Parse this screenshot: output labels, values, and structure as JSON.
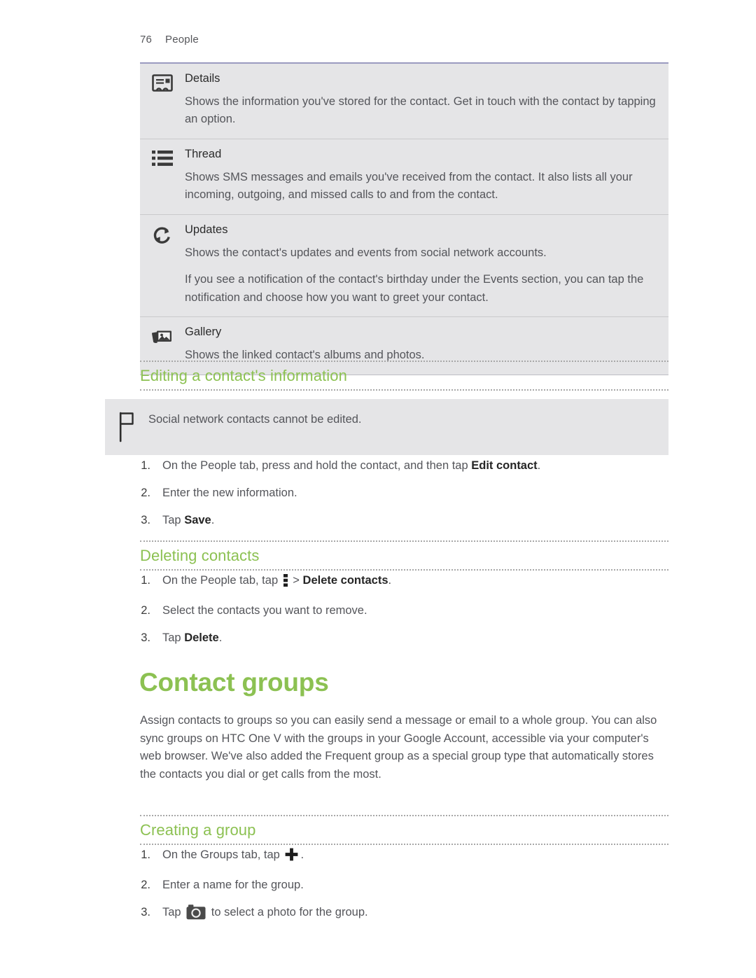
{
  "running_head": {
    "page_number": "76",
    "title": "People"
  },
  "feature_table": {
    "rows": [
      {
        "icon": "contact-card-icon",
        "title": "Details",
        "paragraphs": [
          "Shows the information you've stored for the contact. Get in touch with the contact by tapping an option."
        ]
      },
      {
        "icon": "list-thread-icon",
        "title": "Thread",
        "paragraphs": [
          "Shows SMS messages and emails you've received from the contact. It also lists all your incoming, outgoing, and missed calls to and from the contact."
        ]
      },
      {
        "icon": "refresh-updates-icon",
        "title": "Updates",
        "paragraphs": [
          "Shows the contact's updates and events from social network accounts.",
          "If you see a notification of the contact's birthday under the Events section, you can tap the notification and choose how you want to greet your contact."
        ]
      },
      {
        "icon": "gallery-photos-icon",
        "title": "Gallery",
        "paragraphs": [
          "Shows the linked contact's albums and photos."
        ]
      }
    ]
  },
  "section_editing": {
    "heading": "Editing a contact's information",
    "note": {
      "icon": "flag-icon",
      "text": "Social network contacts cannot be edited."
    },
    "steps": [
      {
        "num": "1.",
        "pre": "On the People tab, press and hold the contact, and then tap ",
        "bold": "Edit contact",
        "post": "."
      },
      {
        "num": "2.",
        "pre": "Enter the new information.",
        "bold": "",
        "post": ""
      },
      {
        "num": "3.",
        "pre": "Tap ",
        "bold": "Save",
        "post": "."
      }
    ]
  },
  "section_deleting": {
    "heading": "Deleting contacts",
    "steps": [
      {
        "num": "1.",
        "pre": "On the People tab, tap ",
        "icon": "overflow-menu-icon",
        "mid": " > ",
        "bold": "Delete contacts",
        "post": "."
      },
      {
        "num": "2.",
        "pre": "Select the contacts you want to remove.",
        "bold": "",
        "post": ""
      },
      {
        "num": "3.",
        "pre": "Tap ",
        "bold": "Delete",
        "post": "."
      }
    ]
  },
  "chapter": {
    "title": "Contact groups",
    "intro": "Assign contacts to groups so you can easily send a message or email to a whole group. You can also sync groups on HTC One V with the groups in your Google Account, accessible via your computer's web browser. We've also added the Frequent group as a special group type that automatically stores the contacts you dial or get calls from the most."
  },
  "section_creating": {
    "heading": "Creating a group",
    "steps": [
      {
        "num": "1.",
        "pre": "On the Groups tab, tap ",
        "icon": "plus-icon",
        "post": "."
      },
      {
        "num": "2.",
        "pre": "Enter a name for the group.",
        "post": ""
      },
      {
        "num": "3.",
        "pre": "Tap ",
        "icon": "camera-icon",
        "post": " to select a photo for the group."
      }
    ]
  },
  "colors": {
    "accent_green": "#8cc152",
    "table_background": "#e5e5e7",
    "table_top_border": "#9a9ac0",
    "body_text": "#54555a"
  }
}
